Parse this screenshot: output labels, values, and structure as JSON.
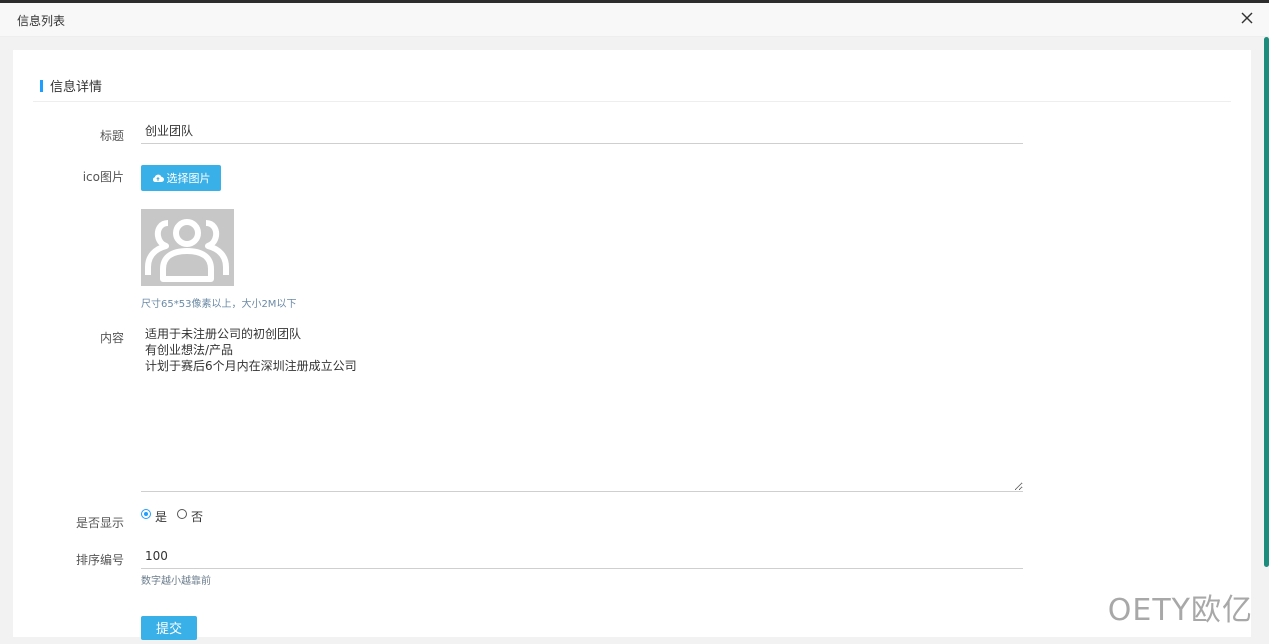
{
  "window": {
    "title": "信息列表"
  },
  "section": {
    "title": "信息详情"
  },
  "form": {
    "title_label": "标题",
    "title_value": "创业团队",
    "icon_label": "ico图片",
    "upload_button_label": "选择图片",
    "icon_hint": "尺寸65*53像素以上，大小2M以下",
    "content_label": "内容",
    "content_value": "适用于未注册公司的初创团队\n有创业想法/产品\n计划于赛后6个月内在深圳注册成立公司",
    "display_label": "是否显示",
    "display_options": [
      {
        "label": "是",
        "checked": true
      },
      {
        "label": "否",
        "checked": false
      }
    ],
    "sort_label": "排序编号",
    "sort_value": "100",
    "sort_hint": "数字越小越靠前",
    "submit_label": "提交"
  },
  "watermark": "OETY欧亿",
  "colors": {
    "accent": "#1e9fff",
    "button": "#3ab0e8",
    "scrollbar": "#1c8c7c"
  },
  "icons": {
    "close": "close-icon",
    "upload": "cloud-upload-icon",
    "avatar": "user-group-icon"
  }
}
